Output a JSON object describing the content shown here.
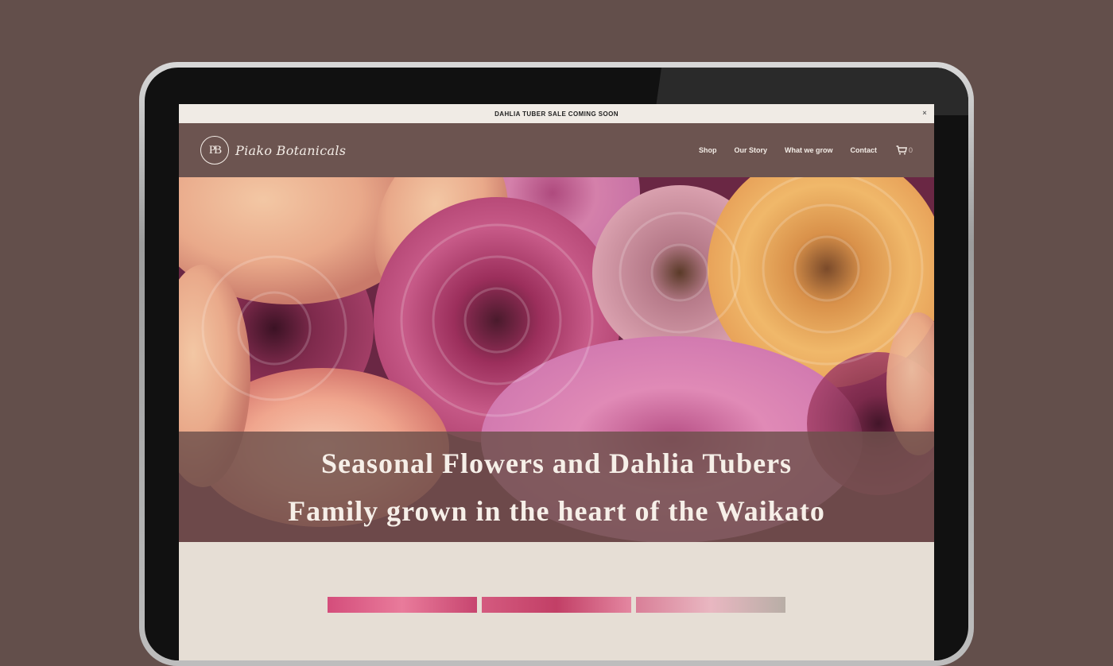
{
  "announcement": {
    "text": "DAHLIA TUBER SALE COMING SOON",
    "close": "×"
  },
  "brand": {
    "monogram": "PB",
    "name": "Piako Botanicals"
  },
  "nav": {
    "items": [
      "Shop",
      "Our Story",
      "What we grow",
      "Contact"
    ]
  },
  "cart": {
    "icon": "cart-icon",
    "count": "0"
  },
  "hero": {
    "line1": "Seasonal Flowers and Dahlia Tubers",
    "line2": "Family grown in the heart of the Waikato"
  },
  "colors": {
    "background": "#634f4b",
    "header": "#6c5450",
    "announcement_bar": "#f0ebe5",
    "hero_band": "#6e504c",
    "section": "#e6ded5"
  }
}
